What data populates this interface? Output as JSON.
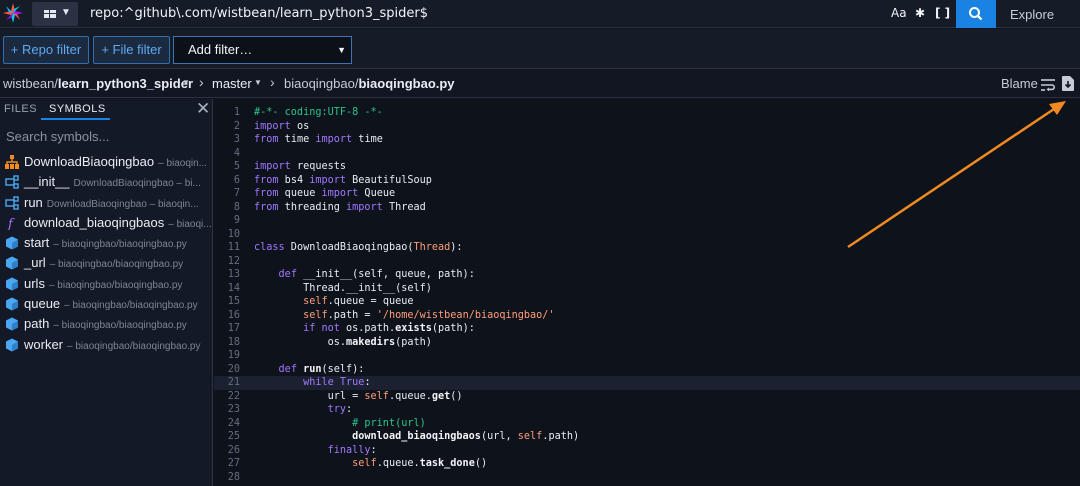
{
  "topbar": {
    "query": "repo:^github\\.com/wistbean/learn_python3_spider$",
    "case_toggle": "Aa",
    "regex_toggle": ".*",
    "structural_toggle": "[ ]",
    "explore_label": "Explore"
  },
  "filters": {
    "repo_filter": "+ Repo filter",
    "file_filter": "+ File filter",
    "add_filter": "Add filter…"
  },
  "breadcrumb": {
    "owner": "wistbean/",
    "repo": "learn_python3_spider",
    "branch": "master",
    "dir": "biaoqingbao",
    "file": "biaoqingbao.py",
    "blame_label": "Blame"
  },
  "sidebar": {
    "tab_files": "FILES",
    "tab_symbols": "SYMBOLS",
    "search_placeholder": "Search symbols...",
    "symbols": [
      {
        "name": "DownloadBiaoqingbao",
        "loc": "– biaoqin...",
        "icon": "class-icon"
      },
      {
        "name": "__init__",
        "loc": "DownloadBiaoqingbao – bi...",
        "icon": "method-icon"
      },
      {
        "name": "run",
        "loc": "DownloadBiaoqingbao – biaoqin...",
        "icon": "method-icon"
      },
      {
        "name": "download_biaoqingbaos",
        "loc": "– biaoqi...",
        "icon": "function-icon"
      },
      {
        "name": "start",
        "loc": "– biaoqingbao/biaoqingbao.py",
        "icon": "variable-icon"
      },
      {
        "name": "_url",
        "loc": "– biaoqingbao/biaoqingbao.py",
        "icon": "variable-icon"
      },
      {
        "name": "urls",
        "loc": "– biaoqingbao/biaoqingbao.py",
        "icon": "variable-icon"
      },
      {
        "name": "queue",
        "loc": "– biaoqingbao/biaoqingbao.py",
        "icon": "variable-icon"
      },
      {
        "name": "path",
        "loc": "– biaoqingbao/biaoqingbao.py",
        "icon": "variable-icon"
      },
      {
        "name": "worker",
        "loc": "– biaoqingbao/biaoqingbao.py",
        "icon": "variable-icon"
      }
    ]
  },
  "code": {
    "highlighted_line": 21,
    "lines": [
      [
        [
          "cm",
          "#-*- coding:UTF-8 -*-"
        ]
      ],
      [
        [
          "kw",
          "import"
        ],
        [
          "",
          " os"
        ]
      ],
      [
        [
          "kw",
          "from"
        ],
        [
          "",
          " time "
        ],
        [
          "kw",
          "import"
        ],
        [
          "",
          " time"
        ]
      ],
      [],
      [
        [
          "kw",
          "import"
        ],
        [
          "",
          " requests"
        ]
      ],
      [
        [
          "kw",
          "from"
        ],
        [
          "",
          " bs4 "
        ],
        [
          "kw",
          "import"
        ],
        [
          "",
          " BeautifulSoup"
        ]
      ],
      [
        [
          "kw",
          "from"
        ],
        [
          "",
          " queue "
        ],
        [
          "kw",
          "import"
        ],
        [
          "",
          " Queue"
        ]
      ],
      [
        [
          "kw",
          "from"
        ],
        [
          "",
          " threading "
        ],
        [
          "kw",
          "import"
        ],
        [
          "",
          " Thread"
        ]
      ],
      [],
      [],
      [
        [
          "kw",
          "class"
        ],
        [
          "",
          " DownloadBiaoqingbao("
        ],
        [
          "tp",
          "Thread"
        ],
        [
          "",
          "):"
        ]
      ],
      [],
      [
        [
          "",
          "    "
        ],
        [
          "kw",
          "def"
        ],
        [
          "",
          " __init__(self, queue, path):"
        ]
      ],
      [
        [
          "",
          "        Thread.__init__(self)"
        ]
      ],
      [
        [
          "",
          "        "
        ],
        [
          "self",
          "self"
        ],
        [
          "",
          ".queue = queue"
        ]
      ],
      [
        [
          "",
          "        "
        ],
        [
          "self",
          "self"
        ],
        [
          "",
          ".path = "
        ],
        [
          "st",
          "'/home/wistbean/biaoqingbao/'"
        ]
      ],
      [
        [
          "",
          "        "
        ],
        [
          "kw",
          "if not"
        ],
        [
          "",
          " os.path."
        ],
        [
          "fn",
          "exists"
        ],
        [
          "",
          "(path):"
        ]
      ],
      [
        [
          "",
          "            os."
        ],
        [
          "fn",
          "makedirs"
        ],
        [
          "",
          "(path)"
        ]
      ],
      [],
      [
        [
          "",
          "    "
        ],
        [
          "kw",
          "def"
        ],
        [
          "",
          " "
        ],
        [
          "fn",
          "run"
        ],
        [
          "",
          "(self):"
        ]
      ],
      [
        [
          "",
          "        "
        ],
        [
          "kw",
          "while"
        ],
        [
          "",
          " "
        ],
        [
          "kw",
          "True"
        ],
        [
          "",
          ":"
        ]
      ],
      [
        [
          "",
          "            url = "
        ],
        [
          "self",
          "self"
        ],
        [
          "",
          ".queue."
        ],
        [
          "fn",
          "get"
        ],
        [
          "",
          "()"
        ]
      ],
      [
        [
          "",
          "            "
        ],
        [
          "kw",
          "try"
        ],
        [
          "",
          ":"
        ]
      ],
      [
        [
          "",
          "                "
        ],
        [
          "cm",
          "# print(url)"
        ]
      ],
      [
        [
          "",
          "                "
        ],
        [
          "fn",
          "download_biaoqingbaos"
        ],
        [
          "",
          "(url, "
        ],
        [
          "self",
          "self"
        ],
        [
          "",
          ".path)"
        ]
      ],
      [
        [
          "",
          "            "
        ],
        [
          "kw",
          "finally"
        ],
        [
          "",
          ":"
        ]
      ],
      [
        [
          "",
          "                "
        ],
        [
          "self",
          "self"
        ],
        [
          "",
          ".queue."
        ],
        [
          "fn",
          "task_done"
        ],
        [
          "",
          "()"
        ]
      ],
      []
    ]
  }
}
